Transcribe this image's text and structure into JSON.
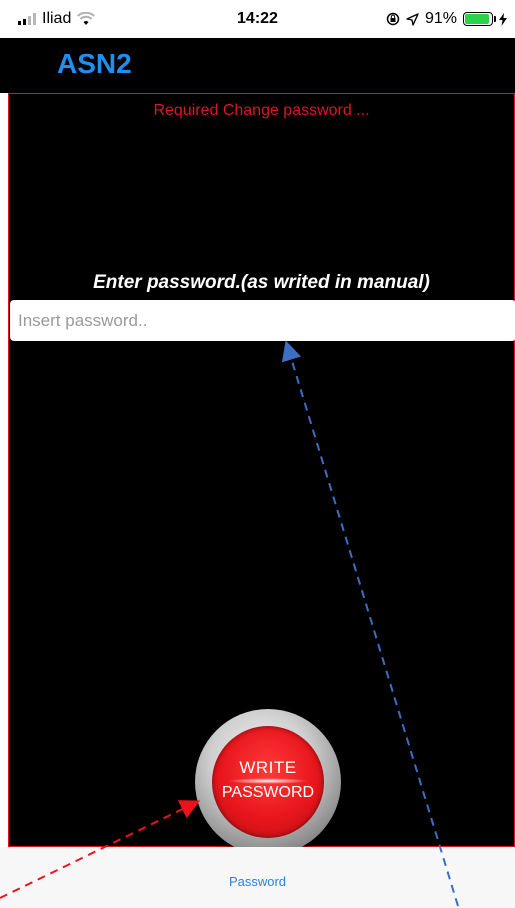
{
  "status_bar": {
    "carrier": "Iliad",
    "time": "14:22",
    "battery_percent": "91%",
    "battery_level": 0.91,
    "icons": [
      "signal-icon",
      "wifi-icon",
      "rotation-lock-icon",
      "location-icon",
      "battery-icon",
      "charging-icon"
    ]
  },
  "nav": {
    "title": "ASN2",
    "title_color": "#1f8ff0"
  },
  "main": {
    "required_message": "Required Change password ...",
    "instruction": "Enter password.(as writed in manual)",
    "password_input": {
      "placeholder": "Insert password..",
      "value": ""
    },
    "write_button": {
      "line1": "WRITE",
      "line2": "PASSWORD"
    }
  },
  "tab_bar": {
    "password_label": "Password"
  },
  "colors": {
    "background": "#000000",
    "border": "#e0141c",
    "required_text": "#d9181f",
    "tab_accent": "#2f7fe0",
    "button_red": "#e8161c",
    "annotation_red": "#e8141c",
    "annotation_blue": "#3a6fc4"
  }
}
